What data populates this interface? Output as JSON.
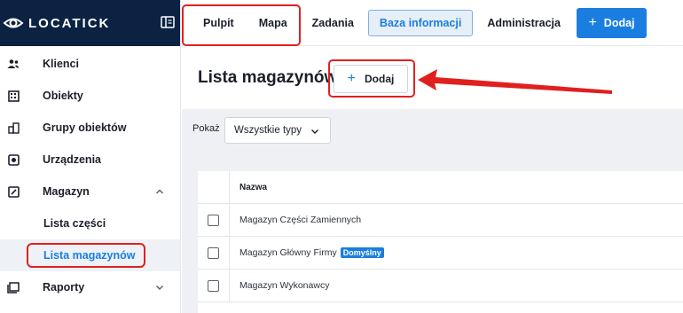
{
  "brand": {
    "name": "LOCATICK"
  },
  "sidebar": {
    "items": [
      {
        "label": "Klienci",
        "icon": "users-icon"
      },
      {
        "label": "Obiekty",
        "icon": "building-icon"
      },
      {
        "label": "Grupy obiektów",
        "icon": "buildings-group-icon"
      },
      {
        "label": "Urządzenia",
        "icon": "device-icon"
      },
      {
        "label": "Magazyn",
        "icon": "warehouse-icon",
        "expanded": true
      },
      {
        "label": "Raporty",
        "icon": "reports-icon",
        "expanded": false
      }
    ],
    "sub_items": [
      {
        "label": "Lista części"
      },
      {
        "label": "Lista magazynów",
        "active": true
      }
    ]
  },
  "topbar": {
    "tabs": [
      {
        "label": "Pulpit"
      },
      {
        "label": "Mapa"
      },
      {
        "label": "Zadania"
      },
      {
        "label": "Baza informacji",
        "active": true
      },
      {
        "label": "Administracja"
      }
    ],
    "add_label": "Dodaj"
  },
  "page": {
    "title": "Lista magazynów",
    "add_label": "Dodaj"
  },
  "filter": {
    "label": "Pokaż",
    "value": "Wszystkie typy"
  },
  "table": {
    "header": "Nazwa",
    "rows": [
      {
        "name": "Magazyn Części Zamiennych",
        "badge": ""
      },
      {
        "name": "Magazyn Główny Firmy",
        "badge": "Domyślny"
      },
      {
        "name": "Magazyn Wykonawcy",
        "badge": ""
      }
    ]
  },
  "colors": {
    "brand": "#0b2242",
    "accent": "#1a7ee0",
    "highlight": "#e0201f"
  }
}
